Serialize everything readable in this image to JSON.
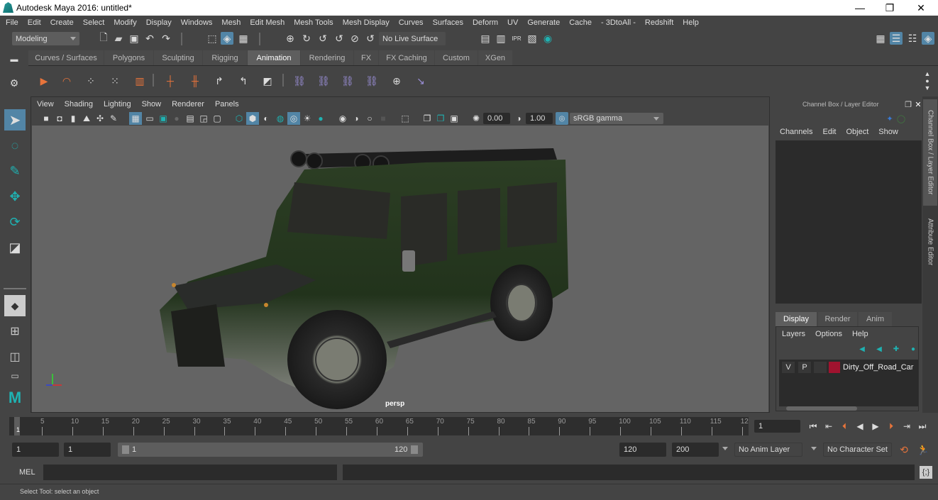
{
  "window": {
    "title": "Autodesk Maya 2016: untitled*",
    "minimize": "—",
    "maximize": "❐",
    "close": "✕"
  },
  "menubar": [
    "File",
    "Edit",
    "Create",
    "Select",
    "Modify",
    "Display",
    "Windows",
    "Mesh",
    "Edit Mesh",
    "Mesh Tools",
    "Mesh Display",
    "Curves",
    "Surfaces",
    "Deform",
    "UV",
    "Generate",
    "Cache",
    "- 3DtoAll -",
    "Redshift",
    "Help"
  ],
  "statusline": {
    "menuset": "Modeling",
    "live_surface": "No Live Surface"
  },
  "shelf": {
    "tabs": [
      "Curves / Surfaces",
      "Polygons",
      "Sculpting",
      "Rigging",
      "Animation",
      "Rendering",
      "FX",
      "FX Caching",
      "Custom",
      "XGen"
    ],
    "active_tab": "Animation"
  },
  "viewport": {
    "menu": [
      "View",
      "Shading",
      "Lighting",
      "Show",
      "Renderer",
      "Panels"
    ],
    "exposure": "0.00",
    "gamma": "1.00",
    "color_space": "sRGB gamma",
    "camera_label": "persp",
    "axis": {
      "x": "x",
      "y": "y",
      "z": "z"
    }
  },
  "channel_box": {
    "title": "Channel Box / Layer Editor",
    "menu": [
      "Channels",
      "Edit",
      "Object",
      "Show"
    ]
  },
  "layer_editor": {
    "tabs": [
      "Display",
      "Render",
      "Anim"
    ],
    "active_tab": "Display",
    "menu": [
      "Layers",
      "Options",
      "Help"
    ],
    "layers": [
      {
        "visible": "V",
        "playback": "P",
        "name": "Dirty_Off_Road_Car",
        "color": "#a0132f"
      }
    ]
  },
  "side_tabs": [
    "Channel Box / Layer Editor",
    "Attribute Editor"
  ],
  "timeline": {
    "ticks": [
      "5",
      "10",
      "15",
      "20",
      "25",
      "30",
      "35",
      "40",
      "45",
      "50",
      "55",
      "60",
      "65",
      "70",
      "75",
      "80",
      "85",
      "90",
      "95",
      "100",
      "105",
      "110",
      "115",
      "12"
    ],
    "current_marker": "1",
    "current_frame": "1"
  },
  "range": {
    "start": "1",
    "playback_start": "1",
    "slider_start": "1",
    "slider_end": "120",
    "playback_end": "120",
    "end": "200",
    "anim_layer": "No Anim Layer",
    "character_set": "No Character Set"
  },
  "cmdline": {
    "label": "MEL"
  },
  "helpline": {
    "text": "Select Tool: select an object"
  },
  "colors": {
    "accent": "#5285a6",
    "teal": "#1fb2b2",
    "orange": "#e8743b",
    "layer_red": "#a0132f"
  }
}
